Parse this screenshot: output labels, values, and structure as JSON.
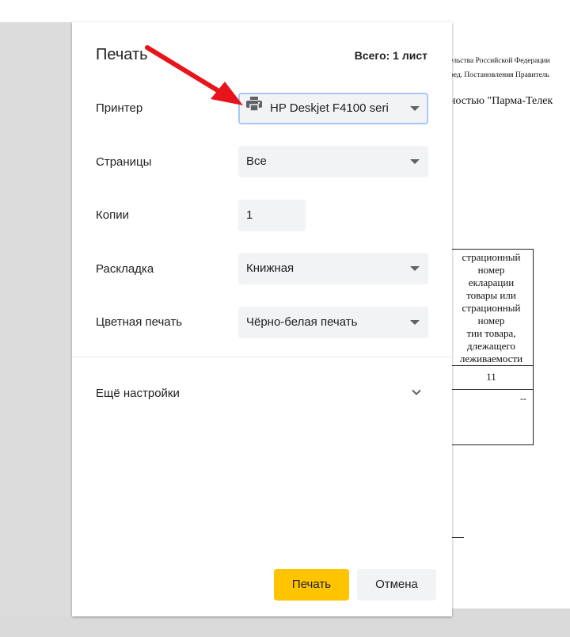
{
  "dialog": {
    "title": "Печать",
    "sheet_count": "Всего: 1 лист"
  },
  "rows": {
    "printer": {
      "label": "Принтер",
      "value": "HP Deskjet F4100 seri",
      "icon": "printer-icon"
    },
    "pages": {
      "label": "Страницы",
      "value": "Все"
    },
    "copies": {
      "label": "Копии",
      "value": "1"
    },
    "layout": {
      "label": "Раскладка",
      "value": "Книжная"
    },
    "color": {
      "label": "Цветная печать",
      "value": "Чёрно-белая печать"
    }
  },
  "more_settings": {
    "label": "Ещё настройки",
    "icon": "chevron-down-icon"
  },
  "buttons": {
    "print": "Печать",
    "cancel": "Отмена"
  },
  "background_document": {
    "header_line_1": "ельства Российской Федерации",
    "header_line_2": "ред. Постановления Правитель",
    "company_line": "ностью \"Парма-Телек",
    "table_cell_lines": [
      "страционный",
      "номер",
      "екларации",
      "товары или",
      "страционный",
      "номер",
      "тии товара,",
      "длежащего",
      "леживаемости"
    ],
    "column_number": "11",
    "dash": "--"
  },
  "annotation": {
    "icon": "red-arrow-icon",
    "color": "#e8141b"
  },
  "colors": {
    "accent_print_button": "#ffc400",
    "field_background": "#f1f3f4",
    "focus_outline": "#a8c7fa"
  }
}
